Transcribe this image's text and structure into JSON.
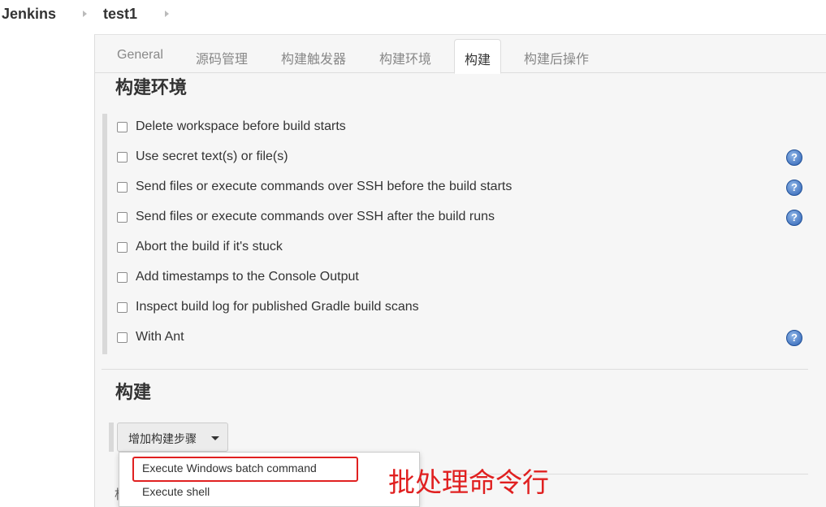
{
  "breadcrumb": {
    "items": [
      "Jenkins",
      "test1"
    ]
  },
  "tabs": [
    {
      "label": "General",
      "active": false
    },
    {
      "label": "源码管理",
      "active": false
    },
    {
      "label": "构建触发器",
      "active": false
    },
    {
      "label": "构建环境",
      "active": false
    },
    {
      "label": "构建",
      "active": true
    },
    {
      "label": "构建后操作",
      "active": false
    }
  ],
  "build_env": {
    "title": "构建环境",
    "options": [
      {
        "label": "Delete workspace before build starts",
        "checked": false,
        "help": false
      },
      {
        "label": "Use secret text(s) or file(s)",
        "checked": false,
        "help": true
      },
      {
        "label": "Send files or execute commands over SSH before the build starts",
        "checked": false,
        "help": true
      },
      {
        "label": "Send files or execute commands over SSH after the build runs",
        "checked": false,
        "help": true
      },
      {
        "label": "Abort the build if it's stuck",
        "checked": false,
        "help": false
      },
      {
        "label": "Add timestamps to the Console Output",
        "checked": false,
        "help": false
      },
      {
        "label": "Inspect build log for published Gradle build scans",
        "checked": false,
        "help": false
      },
      {
        "label": "With Ant",
        "checked": false,
        "help": true
      }
    ]
  },
  "build": {
    "title": "构建",
    "add_step_label": "增加构建步骤",
    "menu_items": [
      "Execute Windows batch command",
      "Execute shell"
    ]
  },
  "help_icon_glyph": "?",
  "partial_text": "构",
  "annotation": {
    "text": "批处理命令行",
    "color": "#e02020"
  }
}
